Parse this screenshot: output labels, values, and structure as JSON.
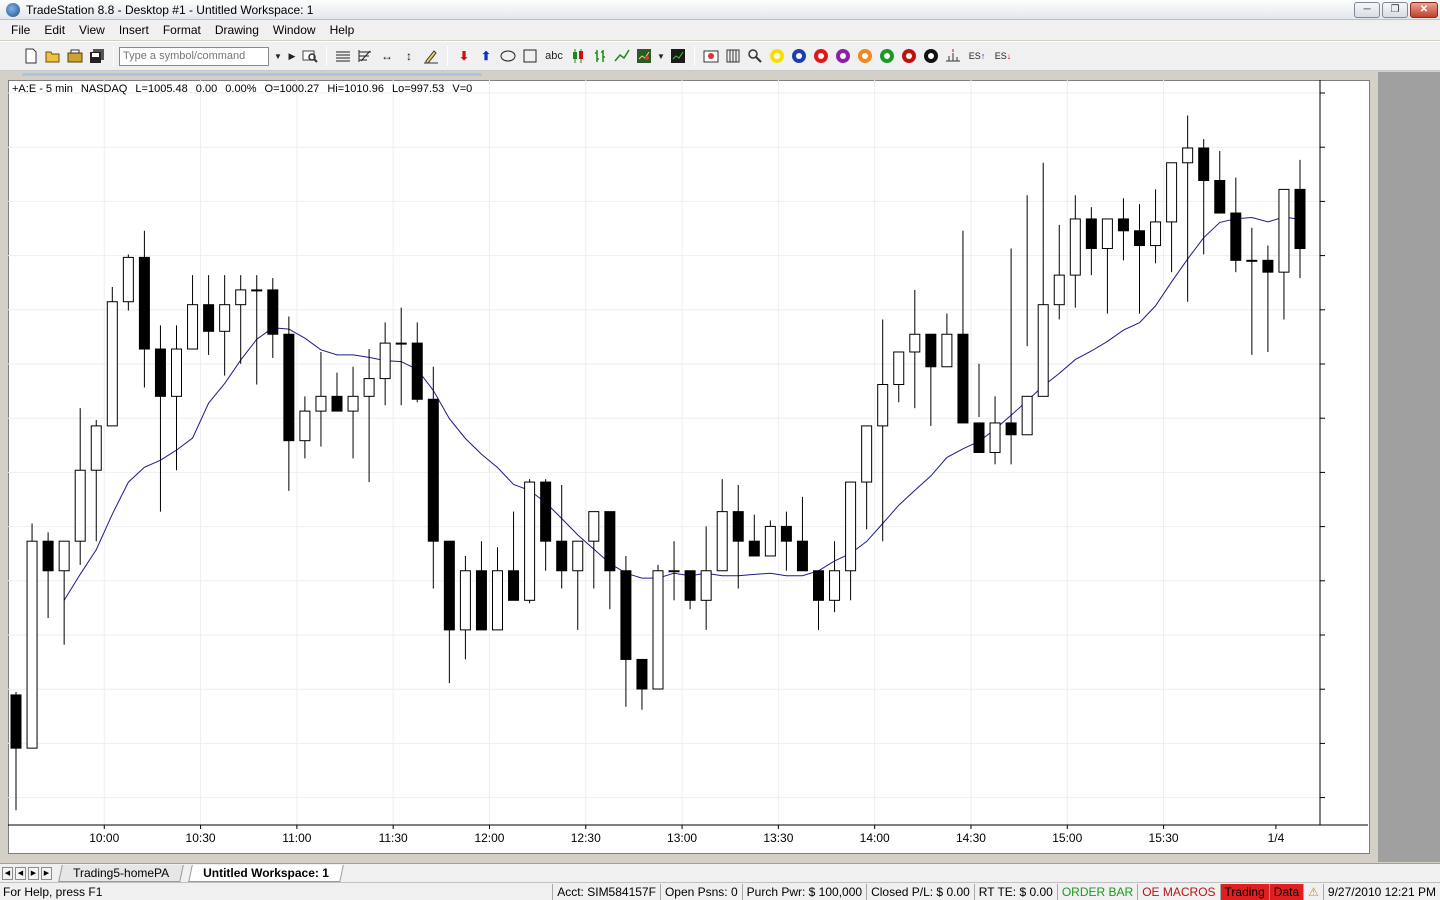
{
  "window": {
    "title": "TradeStation 8.8 - Desktop #1 - Untitled Workspace:  1",
    "controls": [
      "minimize-icon",
      "restore-icon",
      "close-icon"
    ]
  },
  "menu": [
    "File",
    "Edit",
    "View",
    "Insert",
    "Format",
    "Drawing",
    "Window",
    "Help"
  ],
  "toolbar": {
    "symbol_placeholder": "Type a symbol/command",
    "text_tool_label": "abc",
    "es_up_label": "ES",
    "es_down_label": "ES",
    "circle_buttons": [
      {
        "label": "1",
        "color": "#f5e000"
      },
      {
        "label": "2",
        "color": "#1f3faa"
      },
      {
        "label": "3",
        "color": "#e01818"
      },
      {
        "label": "4",
        "color": "#8a1fa8"
      },
      {
        "label": "5",
        "color": "#f08a20"
      },
      {
        "label": "6",
        "color": "#1a9a2a"
      },
      {
        "label": "7",
        "color": "#c01010"
      },
      {
        "label": "8",
        "color": "#111111"
      }
    ]
  },
  "chart_header": {
    "symbol": "+A:E - 5 min",
    "exchange": "NASDAQ",
    "last": "L=1005.48",
    "change": "0.00",
    "change_pct": "0.00%",
    "open": "O=1000.27",
    "high": "Hi=1010.96",
    "low": "Lo=997.53",
    "volume": "V=0"
  },
  "chart_data": {
    "type": "candlestick",
    "x_ticks": [
      {
        "label": "10:00",
        "bar": 5.5
      },
      {
        "label": "10:30",
        "bar": 11.5
      },
      {
        "label": "11:00",
        "bar": 17.5
      },
      {
        "label": "11:30",
        "bar": 23.5
      },
      {
        "label": "12:00",
        "bar": 29.5
      },
      {
        "label": "12:30",
        "bar": 35.5
      },
      {
        "label": "13:00",
        "bar": 41.5
      },
      {
        "label": "13:30",
        "bar": 47.5
      },
      {
        "label": "14:00",
        "bar": 53.5
      },
      {
        "label": "14:30",
        "bar": 59.5
      },
      {
        "label": "15:00",
        "bar": 65.5
      },
      {
        "label": "15:30",
        "bar": 71.5
      },
      {
        "label": "1/4",
        "bar": 78.5
      }
    ],
    "candles": [
      [
        998.2,
        998.3,
        994.3,
        996.4
      ],
      [
        996.4,
        1004.0,
        996.4,
        1003.4
      ],
      [
        1003.4,
        1003.7,
        1000.8,
        1002.4
      ],
      [
        1002.4,
        1003.4,
        999.9,
        1003.4
      ],
      [
        1003.4,
        1007.9,
        1002.6,
        1005.8
      ],
      [
        1005.8,
        1007.5,
        1003.4,
        1007.3
      ],
      [
        1007.3,
        1012.0,
        1007.3,
        1011.5
      ],
      [
        1011.5,
        1013.1,
        1011.2,
        1013.0
      ],
      [
        1013.0,
        1013.9,
        1008.6,
        1009.9
      ],
      [
        1009.9,
        1010.7,
        1004.4,
        1008.3
      ],
      [
        1008.3,
        1010.7,
        1005.8,
        1009.9
      ],
      [
        1009.9,
        1012.4,
        1009.9,
        1011.4
      ],
      [
        1011.4,
        1012.4,
        1009.7,
        1010.5
      ],
      [
        1010.5,
        1012.4,
        1009.0,
        1011.4
      ],
      [
        1011.4,
        1012.4,
        1009.4,
        1011.9
      ],
      [
        1011.9,
        1012.4,
        1008.7,
        1011.9
      ],
      [
        1011.9,
        1012.3,
        1009.6,
        1010.4
      ],
      [
        1010.4,
        1011.0,
        1005.1,
        1006.8
      ],
      [
        1006.8,
        1008.3,
        1006.2,
        1007.8
      ],
      [
        1007.8,
        1009.8,
        1006.6,
        1008.3
      ],
      [
        1008.3,
        1009.1,
        1007.8,
        1007.8
      ],
      [
        1007.8,
        1009.3,
        1006.2,
        1008.3
      ],
      [
        1008.3,
        1009.9,
        1005.4,
        1008.9
      ],
      [
        1008.9,
        1010.8,
        1008.0,
        1010.1
      ],
      [
        1010.1,
        1011.3,
        1008.0,
        1010.1
      ],
      [
        1010.1,
        1010.8,
        1008.1,
        1008.2
      ],
      [
        1008.2,
        1009.3,
        1001.8,
        1003.4
      ],
      [
        1003.4,
        1003.4,
        998.6,
        1000.4
      ],
      [
        1000.4,
        1002.9,
        999.4,
        1002.4
      ],
      [
        1002.4,
        1003.4,
        1000.4,
        1000.4
      ],
      [
        1000.4,
        1003.2,
        1000.4,
        1002.4
      ],
      [
        1002.4,
        1004.4,
        1001.4,
        1001.4
      ],
      [
        1001.4,
        1005.5,
        1001.3,
        1005.4
      ],
      [
        1005.4,
        1005.5,
        1002.4,
        1003.4
      ],
      [
        1003.4,
        1005.3,
        1001.8,
        1002.4
      ],
      [
        1002.4,
        1003.4,
        1000.4,
        1003.4
      ],
      [
        1003.4,
        1004.3,
        1001.8,
        1004.4
      ],
      [
        1004.4,
        1004.4,
        1001.1,
        1002.4
      ],
      [
        1002.4,
        1002.9,
        997.8,
        999.4
      ],
      [
        999.4,
        999.4,
        997.7,
        998.4
      ],
      [
        998.4,
        1002.6,
        998.4,
        1002.4
      ],
      [
        1002.4,
        1003.4,
        1001.4,
        1002.4
      ],
      [
        1002.4,
        1002.4,
        1001.1,
        1001.4
      ],
      [
        1001.4,
        1003.9,
        1000.4,
        1002.4
      ],
      [
        1002.4,
        1005.5,
        1002.4,
        1004.4
      ],
      [
        1004.4,
        1005.3,
        1001.8,
        1003.4
      ],
      [
        1003.4,
        1004.3,
        1003.4,
        1002.9
      ],
      [
        1002.9,
        1004.1,
        1003.4,
        1003.9
      ],
      [
        1003.9,
        1004.4,
        1002.4,
        1003.4
      ],
      [
        1003.4,
        1004.9,
        1002.4,
        1002.4
      ],
      [
        1002.4,
        1002.4,
        1000.4,
        1001.4
      ],
      [
        1001.4,
        1003.4,
        1001.0,
        1002.4
      ],
      [
        1002.4,
        1004.8,
        1001.4,
        1005.4
      ],
      [
        1005.4,
        1006.4,
        1003.8,
        1007.3
      ],
      [
        1007.3,
        1010.9,
        1003.4,
        1008.7
      ],
      [
        1008.7,
        1009.4,
        1008.1,
        1009.8
      ],
      [
        1009.8,
        1011.9,
        1007.9,
        1010.4
      ],
      [
        1010.4,
        1010.4,
        1007.3,
        1009.3
      ],
      [
        1009.3,
        1011.1,
        1009.3,
        1010.4
      ],
      [
        1010.4,
        1013.9,
        1007.4,
        1007.4
      ],
      [
        1007.4,
        1009.4,
        1007.6,
        1006.4
      ],
      [
        1006.4,
        1008.3,
        1006.0,
        1007.4
      ],
      [
        1007.4,
        1013.3,
        1006.0,
        1007.0
      ],
      [
        1007.0,
        1015.1,
        1010.0,
        1008.3
      ],
      [
        1008.3,
        1016.2,
        1010.4,
        1011.4
      ],
      [
        1011.4,
        1014.1,
        1010.9,
        1012.4
      ],
      [
        1012.4,
        1015.1,
        1011.3,
        1014.3
      ],
      [
        1014.3,
        1014.7,
        1012.4,
        1013.3
      ],
      [
        1013.3,
        1014.2,
        1011.1,
        1014.3
      ],
      [
        1014.3,
        1015.0,
        1012.9,
        1013.9
      ],
      [
        1013.9,
        1014.8,
        1011.1,
        1013.4
      ],
      [
        1013.4,
        1015.3,
        1012.8,
        1014.2
      ],
      [
        1014.2,
        1015.0,
        1012.5,
        1016.2
      ],
      [
        1016.2,
        1017.8,
        1011.5,
        1016.7
      ],
      [
        1016.7,
        1017.0,
        1013.1,
        1015.6
      ],
      [
        1015.6,
        1016.6,
        1015.2,
        1014.5
      ],
      [
        1014.5,
        1015.7,
        1012.5,
        1012.9
      ],
      [
        1012.9,
        1014.0,
        1009.7,
        1012.9
      ],
      [
        1012.9,
        1013.4,
        1009.8,
        1012.5
      ],
      [
        1012.5,
        1015.3,
        1010.9,
        1015.3
      ],
      [
        1015.3,
        1016.3,
        1012.3,
        1013.3
      ]
    ]
  },
  "tabs": [
    {
      "label": "Trading5-homePA",
      "active": false
    },
    {
      "label": "Untitled Workspace:  1",
      "active": true
    }
  ],
  "status": {
    "help": "For Help, press F1",
    "acct": "Acct: SIM584157F",
    "open_psns": "Open Psns: 0",
    "purch_pwr": "Purch Pwr: $ 100,000",
    "closed_pl": "Closed P/L: $ 0.00",
    "rt_te": "RT TE: $ 0.00",
    "order_bar": "ORDER BAR",
    "oe_macros": "OE MACROS",
    "trading": "Trading",
    "data": "Data",
    "datetime": "9/27/2010 12:21 PM"
  }
}
